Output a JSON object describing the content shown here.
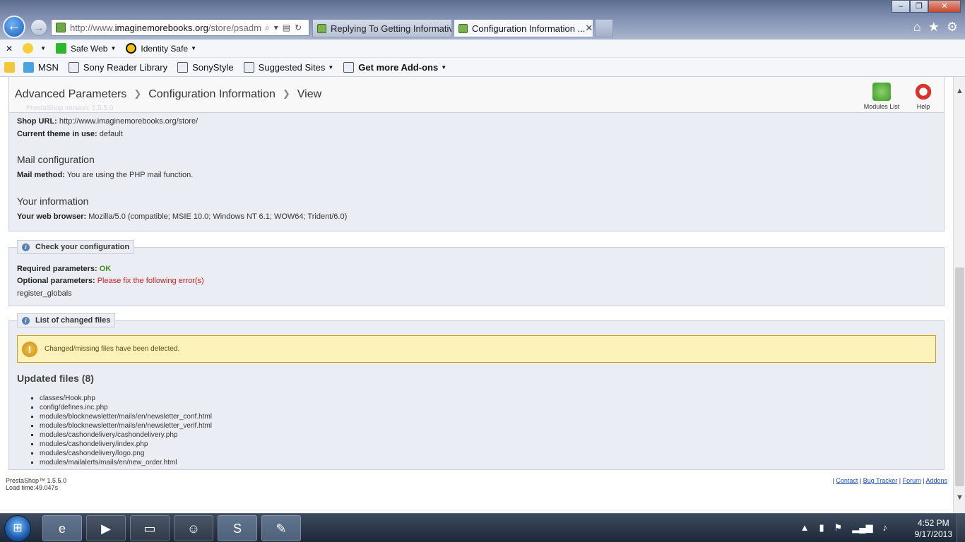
{
  "browser": {
    "url_prefix": "http://www.",
    "url_domain": "imaginemorebooks.org",
    "url_rest": "/store/psadmin",
    "tabs": [
      {
        "label": "Replying To Getting Informativ..."
      },
      {
        "label": "Configuration Information ..."
      }
    ],
    "command_bar": [
      {
        "label": "Safe Web"
      },
      {
        "label": "Identity Safe"
      }
    ],
    "favorites_bar": [
      {
        "label": "MSN"
      },
      {
        "label": "Sony Reader Library"
      },
      {
        "label": "SonyStyle"
      },
      {
        "label": "Suggested Sites"
      },
      {
        "label": "Get more Add-ons"
      }
    ]
  },
  "toolbar": {
    "breadcrumb": [
      "Advanced Parameters",
      "Configuration Information",
      "View"
    ],
    "modules_label": "Modules List",
    "help_label": "Help"
  },
  "info": {
    "ghost_line": "PrestaShop version: 1.5.5.0",
    "shop_url_label": "Shop URL:",
    "shop_url_value": "http://www.imaginemorebooks.org/store/",
    "theme_label": "Current theme in use:",
    "theme_value": "default",
    "mail_heading": "Mail configuration",
    "mail_method_label": "Mail method:",
    "mail_method_value": "You are using the PHP mail function.",
    "your_info_heading": "Your information",
    "browser_label": "Your web browser:",
    "browser_value": "Mozilla/5.0 (compatible; MSIE 10.0; Windows NT 6.1; WOW64; Trident/6.0)"
  },
  "check": {
    "legend": "Check your configuration",
    "required_label": "Required parameters:",
    "required_value": "OK",
    "optional_label": "Optional parameters:",
    "optional_value": "Please fix the following error(s)",
    "error_item": "register_globals"
  },
  "files": {
    "legend": "List of changed files",
    "warning": "Changed/missing files have been detected.",
    "updated_heading": "Updated files (8)",
    "list": [
      "classes/Hook.php",
      "config/defines.inc.php",
      "modules/blocknewsletter/mails/en/newsletter_conf.html",
      "modules/blocknewsletter/mails/en/newsletter_verif.html",
      "modules/cashondelivery/cashondelivery.php",
      "modules/cashondelivery/index.php",
      "modules/cashondelivery/logo.png",
      "modules/mailalerts/mails/en/new_order.html"
    ]
  },
  "footer": {
    "version": "PrestaShop™ 1.5.5.0",
    "load_time": "Load time:49.047s",
    "links": [
      "Contact",
      "Bug Tracker",
      "Forum",
      "Addons"
    ]
  },
  "taskbar": {
    "time": "4:52 PM",
    "date": "9/17/2013"
  }
}
